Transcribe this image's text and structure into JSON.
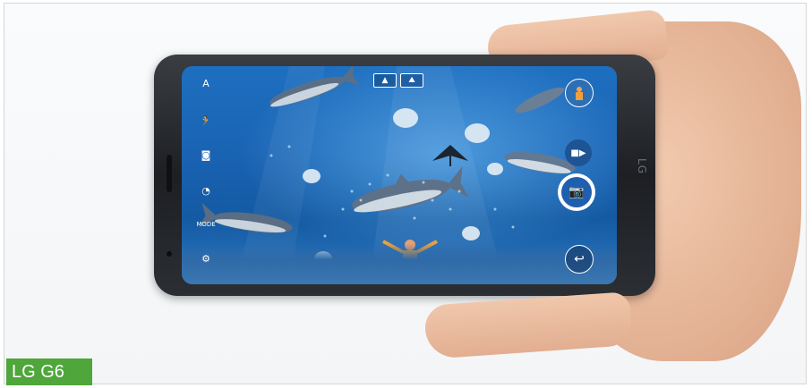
{
  "caption": {
    "text": "LG G6",
    "color": "#4fa63b"
  },
  "phone": {
    "brand_mark": "LG",
    "left_controls": [
      {
        "name": "auto-mode-icon",
        "glyph": "A"
      },
      {
        "name": "run-icon",
        "glyph": "🏃"
      },
      {
        "name": "camera-switch-icon",
        "glyph": "◙"
      },
      {
        "name": "timer-icon",
        "glyph": "◔"
      },
      {
        "name": "mode-icon",
        "glyph": "MODE"
      },
      {
        "name": "settings-icon",
        "glyph": "⚙"
      }
    ],
    "top_modes": [
      {
        "name": "wide-lens-mode",
        "glyph": "▲"
      },
      {
        "name": "standard-lens-mode",
        "glyph": "⛰"
      }
    ],
    "right_controls": {
      "gallery_thumb": "gallery-thumbnail",
      "video_icon": "■▶",
      "shutter_icon": "📷",
      "back_icon": "↩"
    }
  },
  "colors": {
    "water": "#1a63b3",
    "shutter_ring": "#ffffff",
    "shutter_fill": "#1f5fae"
  }
}
